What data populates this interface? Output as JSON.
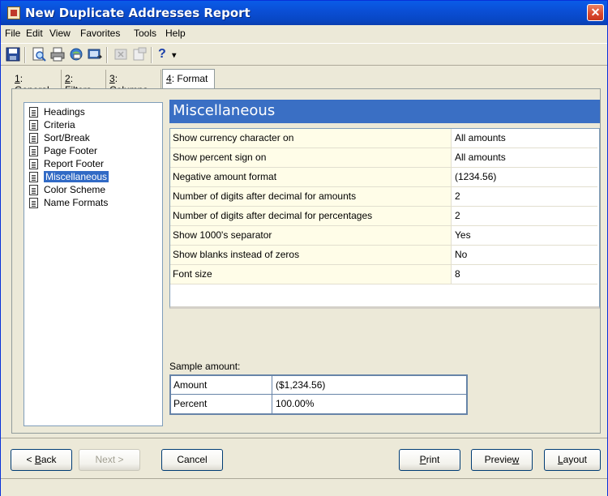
{
  "window": {
    "title": "New Duplicate Addresses Report",
    "close_glyph": "✕"
  },
  "menu": [
    "File",
    "Edit",
    "View",
    "Favorites",
    "Tools",
    "Help"
  ],
  "toolbar": {
    "icons": [
      "save-icon",
      "print-preview-icon",
      "print-icon",
      "email-icon",
      "export-icon",
      "delete-icon",
      "properties-icon",
      "help-icon",
      "dropdown-arrow-icon"
    ],
    "help_glyph": "?",
    "dropdown_glyph": "▾"
  },
  "tabs": [
    {
      "key": "1",
      "label": "General"
    },
    {
      "key": "2",
      "label": "Filters"
    },
    {
      "key": "3",
      "label": "Columns"
    },
    {
      "key": "4",
      "label": "Format"
    }
  ],
  "nav": {
    "items": [
      "Headings",
      "Criteria",
      "Sort/Break",
      "Page Footer",
      "Report Footer",
      "Miscellaneous",
      "Color Scheme",
      "Name Formats"
    ],
    "selected": "Miscellaneous"
  },
  "section": {
    "title": "Miscellaneous"
  },
  "properties": [
    {
      "name": "Show currency character on",
      "value": "All amounts"
    },
    {
      "name": "Show percent sign on",
      "value": "All amounts"
    },
    {
      "name": "Negative amount format",
      "value": "(1234.56)"
    },
    {
      "name": "Number of digits after decimal for amounts",
      "value": "2"
    },
    {
      "name": "Number of digits after decimal for percentages",
      "value": "2"
    },
    {
      "name": "Show 1000's separator",
      "value": "Yes"
    },
    {
      "name": "Show blanks instead of zeros",
      "value": "No"
    },
    {
      "name": "Font size",
      "value": "8"
    }
  ],
  "sample": {
    "label": "Sample amount:",
    "rows": [
      {
        "name": "Amount",
        "value": "($1,234.56)"
      },
      {
        "name": "Percent",
        "value": "100.00%"
      }
    ]
  },
  "buttons": {
    "back": {
      "prefix": "< ",
      "accel": "B",
      "rest": "ack"
    },
    "next": {
      "label": "Next >"
    },
    "cancel": {
      "label": "Cancel"
    },
    "print": {
      "accel": "P",
      "rest": "rint"
    },
    "preview": {
      "pre": "Previe",
      "accel": "w"
    },
    "layout": {
      "accel": "L",
      "rest": "ayout"
    }
  },
  "colors": {
    "accent": "#3a6fc4",
    "selection": "#316ac5",
    "property_bg": "#fffde8",
    "title_bar": "#0a4fd6"
  }
}
